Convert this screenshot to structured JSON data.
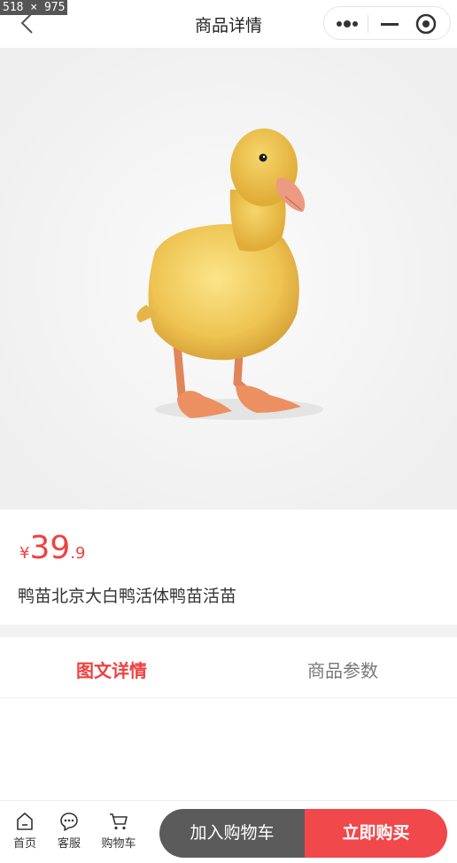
{
  "size_tag": "518 × 975",
  "nav": {
    "title": "商品详情"
  },
  "product": {
    "currency": "¥",
    "price_int": "39",
    "price_dec": ".9",
    "name": "鸭苗北京大白鸭活体鸭苗活苗"
  },
  "tabs": [
    {
      "label": "图文详情"
    },
    {
      "label": "商品参数"
    }
  ],
  "bottom": {
    "items": [
      {
        "label": "首页",
        "icon": "home-icon"
      },
      {
        "label": "客服",
        "icon": "chat-icon"
      },
      {
        "label": "购物车",
        "icon": "cart-icon"
      }
    ],
    "add_to_cart": "加入购物车",
    "buy_now": "立即购买"
  },
  "colors": {
    "accent": "#f04040",
    "cart_button": "#5b5b5b",
    "buy_button": "#f0484b"
  }
}
